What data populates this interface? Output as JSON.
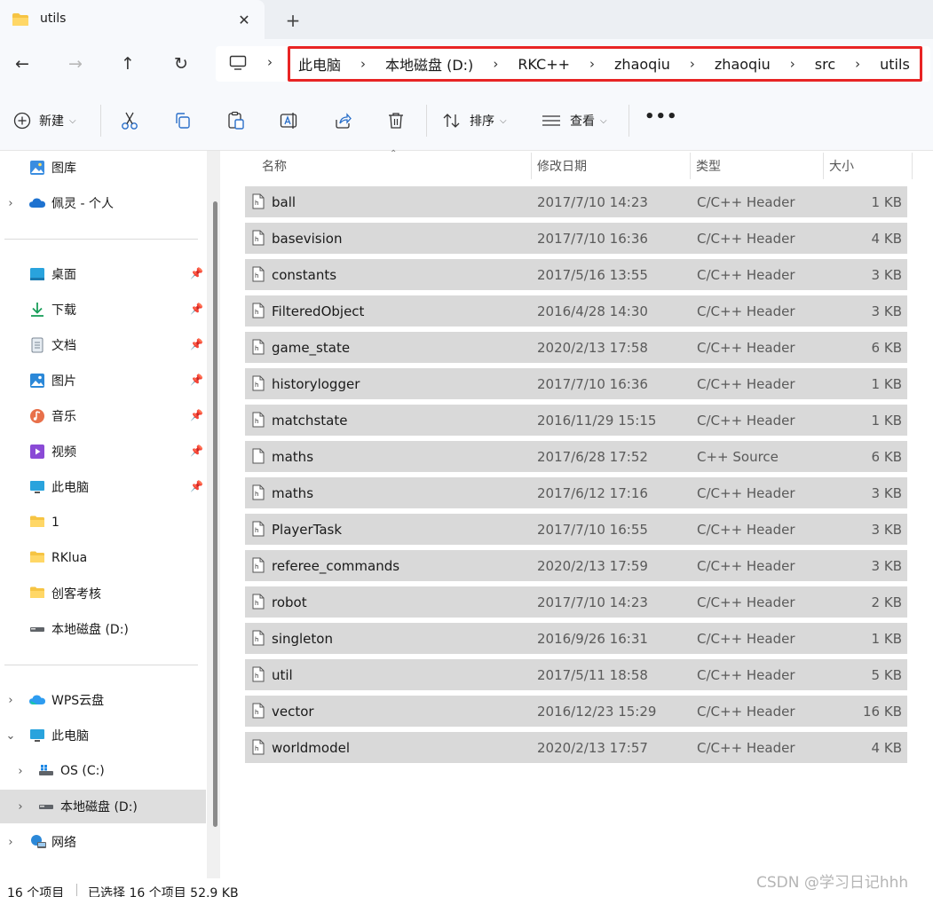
{
  "tab": {
    "title": "utils",
    "close_glyph": "✕",
    "new_glyph": "+"
  },
  "nav": {
    "back": "←",
    "forward": "→",
    "up": "↑",
    "refresh": "↻",
    "sep": "›"
  },
  "breadcrumbs": [
    "此电脑",
    "本地磁盘 (D:)",
    "RKC++",
    "zhaoqiu",
    "zhaoqiu",
    "src",
    "utils"
  ],
  "toolbar": {
    "new_label": "新建",
    "sort_label": "排序",
    "view_label": "查看",
    "more_label": "•••"
  },
  "sidebar": {
    "gallery": "图库",
    "onedrive": "佩灵 - 个人",
    "desktop": "桌面",
    "downloads": "下载",
    "documents": "文档",
    "pictures": "图片",
    "music": "音乐",
    "videos": "视频",
    "thispc_pinned": "此电脑",
    "folder_1": "1",
    "folder_rklua": "RKlua",
    "folder_chuangke": "创客考核",
    "drive_d_pinned": "本地磁盘 (D:)",
    "wps": "WPS云盘",
    "thispc": "此电脑",
    "drive_c": "OS (C:)",
    "drive_d": "本地磁盘 (D:)",
    "network": "网络"
  },
  "columns": {
    "name": "名称",
    "date": "修改日期",
    "type": "类型",
    "size": "大小"
  },
  "files": [
    {
      "name": "ball",
      "date": "2017/7/10 14:23",
      "type": "C/C++ Header",
      "size": "1 KB",
      "icon": "header-file-icon"
    },
    {
      "name": "basevision",
      "date": "2017/7/10 16:36",
      "type": "C/C++ Header",
      "size": "4 KB",
      "icon": "header-file-icon"
    },
    {
      "name": "constants",
      "date": "2017/5/16 13:55",
      "type": "C/C++ Header",
      "size": "3 KB",
      "icon": "header-file-icon"
    },
    {
      "name": "FilteredObject",
      "date": "2016/4/28 14:30",
      "type": "C/C++ Header",
      "size": "3 KB",
      "icon": "header-file-icon"
    },
    {
      "name": "game_state",
      "date": "2020/2/13 17:58",
      "type": "C/C++ Header",
      "size": "6 KB",
      "icon": "header-file-icon"
    },
    {
      "name": "historylogger",
      "date": "2017/7/10 16:36",
      "type": "C/C++ Header",
      "size": "1 KB",
      "icon": "header-file-icon"
    },
    {
      "name": "matchstate",
      "date": "2016/11/29 15:15",
      "type": "C/C++ Header",
      "size": "1 KB",
      "icon": "header-file-icon"
    },
    {
      "name": "maths",
      "date": "2017/6/28 17:52",
      "type": "C++ Source",
      "size": "6 KB",
      "icon": "source-file-icon"
    },
    {
      "name": "maths",
      "date": "2017/6/12 17:16",
      "type": "C/C++ Header",
      "size": "3 KB",
      "icon": "header-file-icon"
    },
    {
      "name": "PlayerTask",
      "date": "2017/7/10 16:55",
      "type": "C/C++ Header",
      "size": "3 KB",
      "icon": "header-file-icon"
    },
    {
      "name": "referee_commands",
      "date": "2020/2/13 17:59",
      "type": "C/C++ Header",
      "size": "3 KB",
      "icon": "header-file-icon"
    },
    {
      "name": "robot",
      "date": "2017/7/10 14:23",
      "type": "C/C++ Header",
      "size": "2 KB",
      "icon": "header-file-icon"
    },
    {
      "name": "singleton",
      "date": "2016/9/26 16:31",
      "type": "C/C++ Header",
      "size": "1 KB",
      "icon": "header-file-icon"
    },
    {
      "name": "util",
      "date": "2017/5/11 18:58",
      "type": "C/C++ Header",
      "size": "5 KB",
      "icon": "header-file-icon"
    },
    {
      "name": "vector",
      "date": "2016/12/23 15:29",
      "type": "C/C++ Header",
      "size": "16 KB",
      "icon": "header-file-icon"
    },
    {
      "name": "worldmodel",
      "date": "2020/2/13 17:57",
      "type": "C/C++ Header",
      "size": "4 KB",
      "icon": "header-file-icon"
    }
  ],
  "status": {
    "count": "16 个项目",
    "selected": "已选择 16 个项目 52.9 KB"
  },
  "watermark": "CSDN @学习日记hhh",
  "colors": {
    "highlight_box": "#e82424",
    "row_selected": "#d9d9d9",
    "folder": "#f6c443"
  }
}
